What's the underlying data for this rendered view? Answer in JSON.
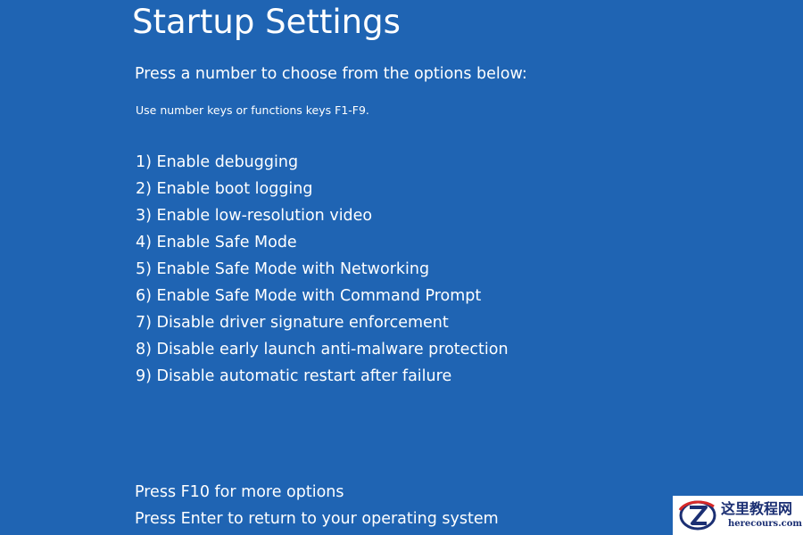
{
  "title": "Startup Settings",
  "instruction": "Press a number to choose from the options below:",
  "hint": "Use number keys or functions keys F1-F9.",
  "options": [
    "1) Enable debugging",
    "2) Enable boot logging",
    "3) Enable low-resolution video",
    "4) Enable Safe Mode",
    "5) Enable Safe Mode with Networking",
    "6) Enable Safe Mode with Command Prompt",
    "7) Disable driver signature enforcement",
    "8) Disable early launch anti-malware protection",
    "9) Disable automatic restart after failure"
  ],
  "footer": [
    "Press F10 for more options",
    "Press Enter to return to your operating system"
  ],
  "watermark": {
    "text": "这里教程网",
    "url": "herecours.com",
    "icon": "z-logo-icon"
  },
  "colors": {
    "background": "#1f64b3",
    "text": "#ffffff"
  }
}
